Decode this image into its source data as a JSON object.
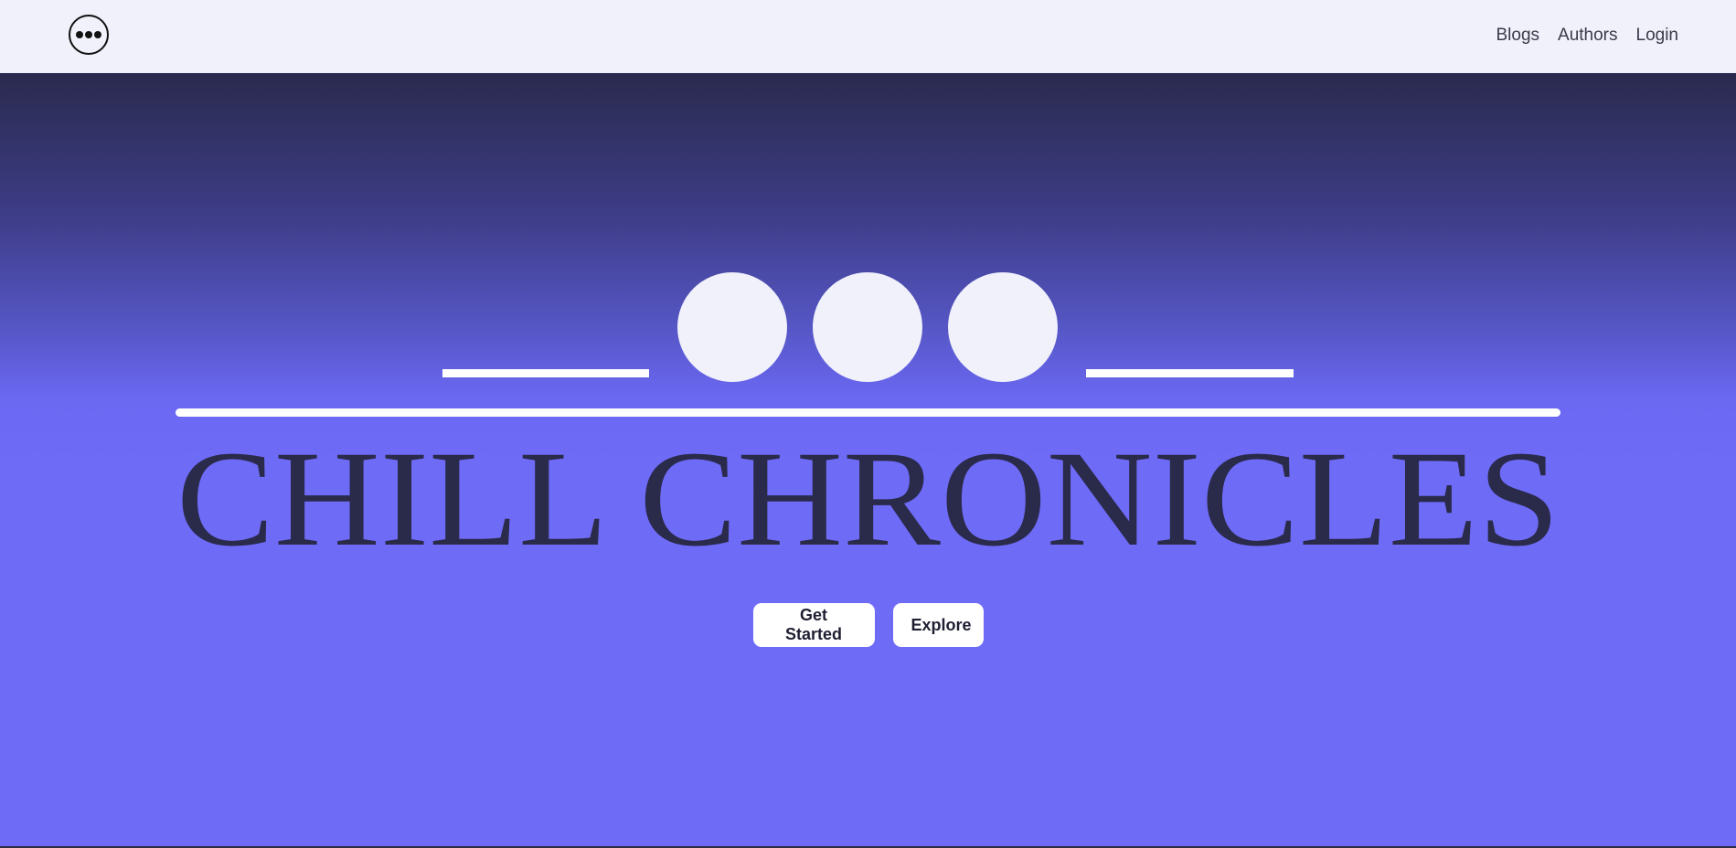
{
  "nav": {
    "logo_icon": "three-dots-circle-icon",
    "links": [
      "Blogs",
      "Authors",
      "Login"
    ]
  },
  "hero": {
    "title": "CHILL CHRONICLES",
    "logo_icon": "three-circles-emblem",
    "buttons": {
      "get_started": "Get Started",
      "explore": "Explore"
    }
  },
  "colors": {
    "nav_bg": "#f0f1fb",
    "hero_top": "#2a2a4e",
    "hero_main": "#6e6bf7",
    "title_color": "#2a2a4a",
    "emblem_color": "#f0f1fb",
    "button_bg": "#ffffff",
    "button_text": "#1f1f33"
  }
}
